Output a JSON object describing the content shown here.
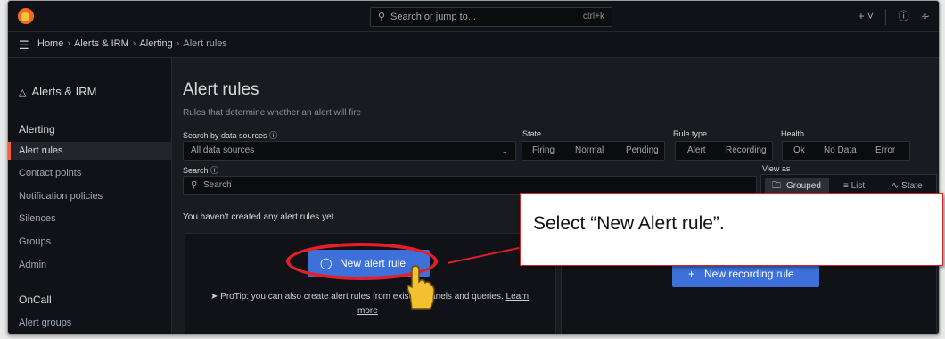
{
  "topbar": {
    "search_placeholder": "Search or jump to...",
    "search_shortcut": "ctrl+k",
    "plus_label": "+ ˅",
    "help_icon": "?",
    "feed_icon": "rss"
  },
  "breadcrumb": {
    "items": [
      "Home",
      "Alerts & IRM",
      "Alerting",
      "Alert rules"
    ]
  },
  "sidebar": {
    "title": "Alerts & IRM",
    "sections": [
      {
        "heading": "Alerting",
        "items": [
          "Alert rules",
          "Contact points",
          "Notification policies",
          "Silences",
          "Groups",
          "Admin"
        ]
      },
      {
        "heading": "OnCall",
        "items": [
          "Alert groups"
        ]
      }
    ],
    "active_item": "Alert rules"
  },
  "main": {
    "title": "Alert rules",
    "subtitle": "Rules that determine whether an alert will fire",
    "filters": {
      "datasource_label": "Search by data sources",
      "datasource_value": "All data sources",
      "state_label": "State",
      "state_options": [
        "Firing",
        "Normal",
        "Pending"
      ],
      "ruletype_label": "Rule type",
      "ruletype_options": [
        "Alert",
        "Recording"
      ],
      "health_label": "Health",
      "health_options": [
        "Ok",
        "No Data",
        "Error"
      ],
      "search_label": "Search",
      "search_placeholder": "Search",
      "viewas_label": "View as",
      "viewas_options": [
        "Grouped",
        "List",
        "State"
      ],
      "viewas_selected": "Grouped"
    },
    "empty_message": "You haven't created any alert rules yet",
    "new_alert_button": "New alert rule",
    "new_recording_button": "New recording rule",
    "protip_line1": "ProTip: you can also create alert rules from existing panels and queries.",
    "protip_link_a": "Learn",
    "protip_link_b": "more"
  },
  "annotation": {
    "callout_text": "Select “New Alert rule”.",
    "highlight_color": "#e3202a"
  },
  "colors": {
    "accent_blue": "#3d71d9",
    "active_marker": "#f55f3e",
    "background": "#181b1f"
  }
}
